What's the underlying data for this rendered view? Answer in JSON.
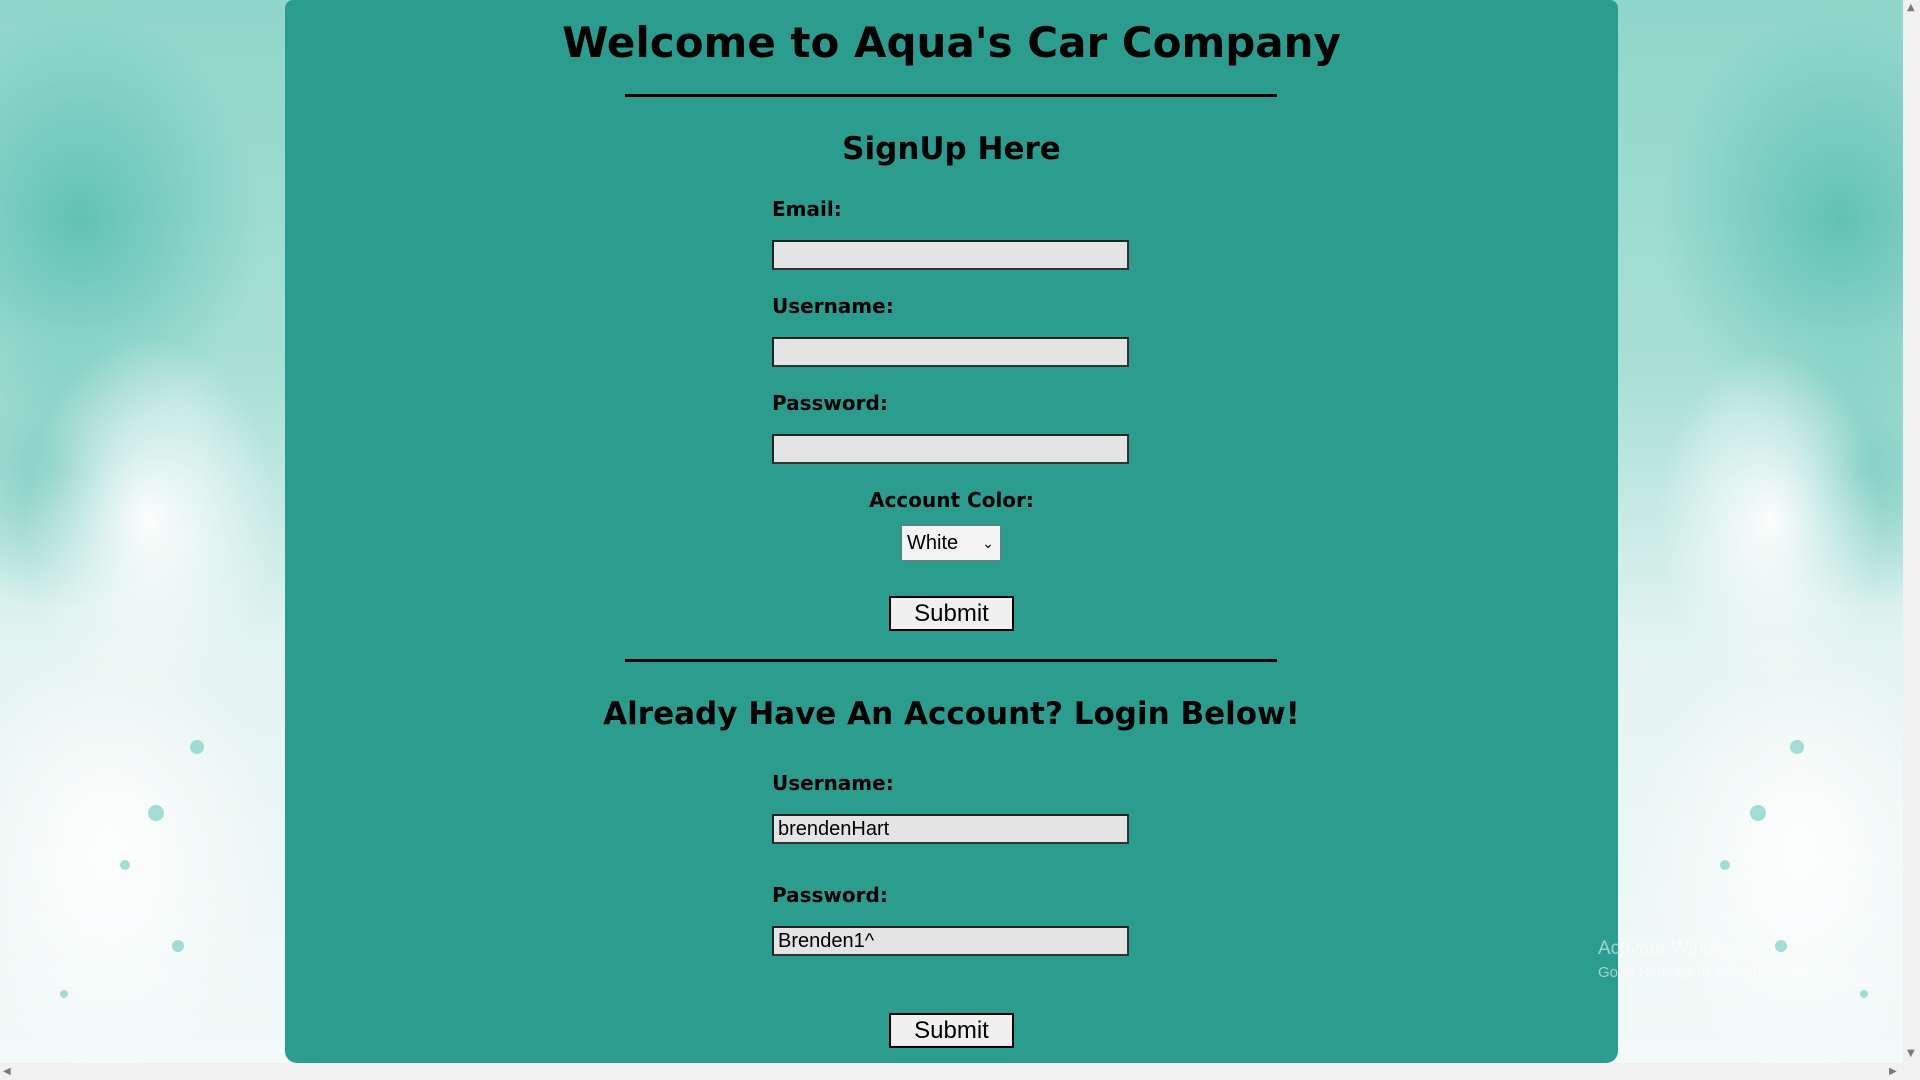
{
  "page": {
    "title": "Welcome to Aqua's Car Company"
  },
  "signup": {
    "heading": "SignUp Here",
    "email_label": "Email:",
    "email_value": "",
    "username_label": "Username:",
    "username_value": "",
    "password_label": "Password:",
    "password_value": "",
    "color_label": "Account Color:",
    "color_selected": "White",
    "submit_label": "Submit"
  },
  "login": {
    "heading": "Already Have An Account? Login Below!",
    "username_label": "Username:",
    "username_value": "brendenHart",
    "password_label": "Password:",
    "password_value": "Brenden1^",
    "submit_label": "Submit"
  },
  "watermark": {
    "line1": "Activate Windows",
    "line2": "Go to Settings to activate Windows."
  },
  "colors": {
    "panel": "#2a9d8f",
    "background": "#a9e0d7"
  },
  "icons": {
    "select_chevron": "chevron-down-icon",
    "scroll_up": "arrow-up-icon",
    "scroll_down": "arrow-down-icon",
    "scroll_left": "arrow-left-icon",
    "scroll_right": "arrow-right-icon"
  }
}
